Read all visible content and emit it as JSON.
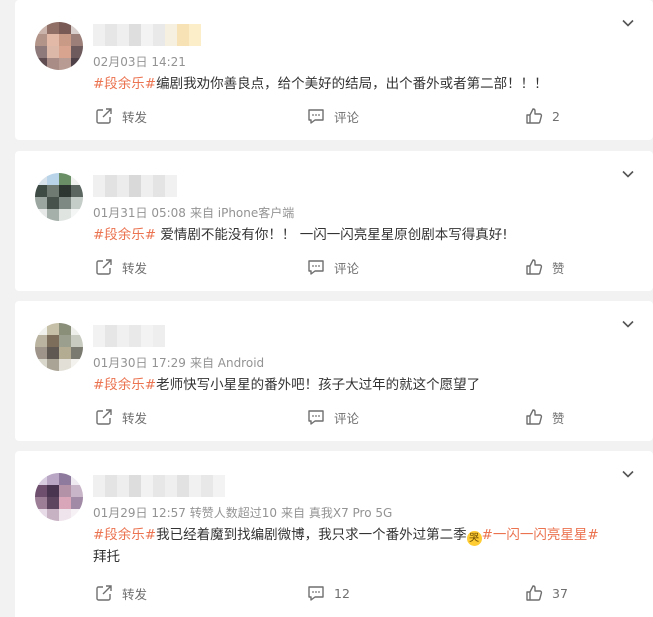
{
  "colors": {
    "accent_topic": "#eb7350",
    "meta_gray": "#939393",
    "icon_gray": "#6f6f6f",
    "background": "#f2f2f2",
    "card": "#ffffff"
  },
  "icons": {
    "more": "chevron-down-icon",
    "forward": "forward-share-icon",
    "comment": "comment-bubble-icon",
    "like": "thumbs-up-icon"
  },
  "comments": [
    {
      "time": "02月03日 14:21",
      "source": "",
      "topic": "#段余乐#",
      "body": "编剧我劝你善良点，给个美好的结局，出个番外或者第二部！！！",
      "actions": {
        "forward": "转发",
        "comment": "评论",
        "like": "2"
      }
    },
    {
      "time": "01月31日 05:08",
      "source": "来自 iPhone客户端",
      "topic": "#段余乐#",
      "body": " 爱情剧不能没有你！！ 一闪一闪亮星星原创剧本写得真好!",
      "actions": {
        "forward": "转发",
        "comment": "评论",
        "like": "赞"
      }
    },
    {
      "time": "01月30日 17:29",
      "source": "来自 Android",
      "topic": "#段余乐#",
      "body": "老师快写小星星的番外吧！孩子大过年的就这个愿望了",
      "actions": {
        "forward": "转发",
        "comment": "评论",
        "like": "赞"
      }
    },
    {
      "time": "01月29日 12:57 转赞人数超过10",
      "source": "来自 真我X7 Pro 5G",
      "topic": "#段余乐#",
      "body": "我已经着魔到找编剧微博，我只求一个番外过第二季",
      "emoji_alt": "哭",
      "topic2": "#一闪一闪亮星星#",
      "body2": " 拜托",
      "actions": {
        "forward": "转发",
        "comment": "12",
        "like": "37"
      }
    }
  ]
}
